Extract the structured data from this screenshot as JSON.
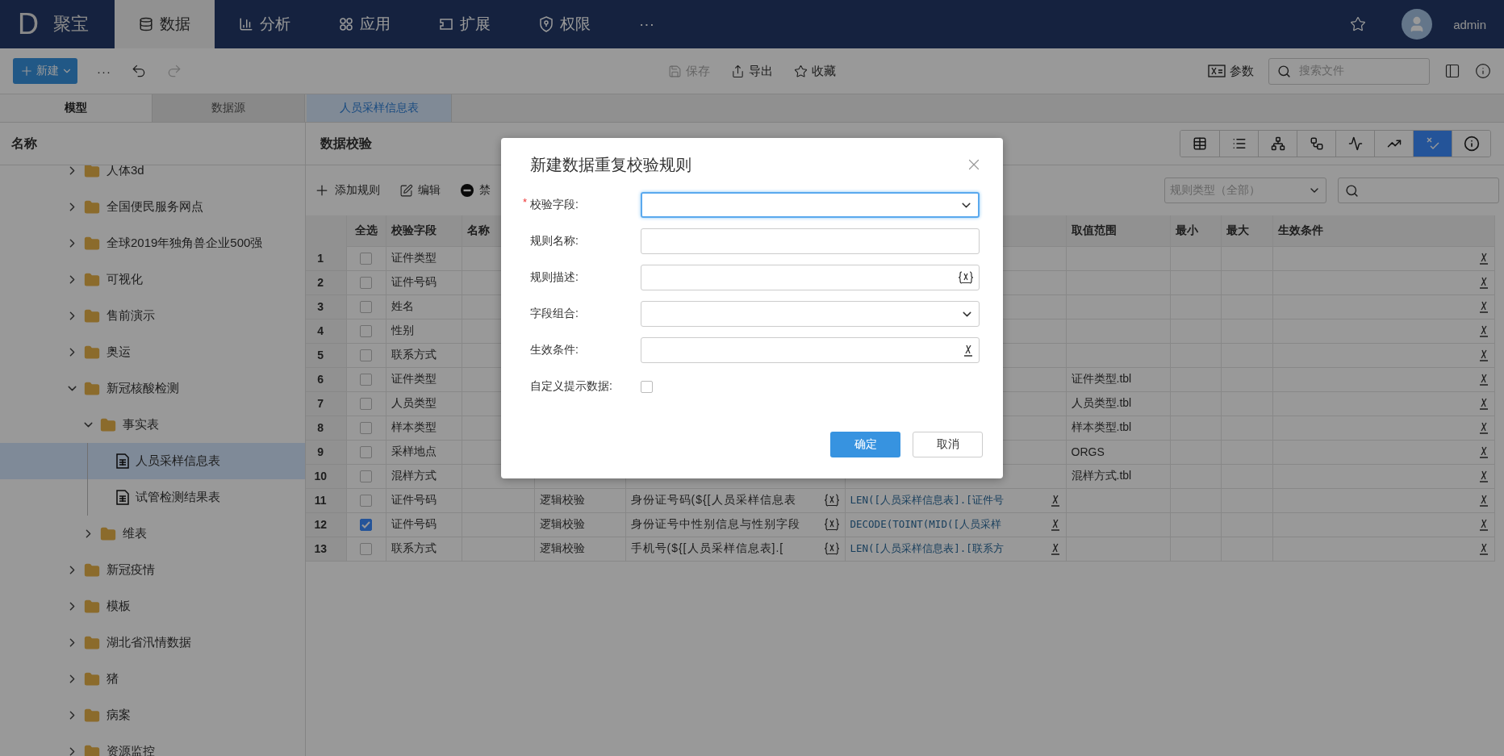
{
  "app": {
    "logo": "D",
    "name": "聚宝"
  },
  "nav": [
    {
      "label": "数据",
      "selected": true
    },
    {
      "label": "分析",
      "selected": false
    },
    {
      "label": "应用",
      "selected": false
    },
    {
      "label": "扩展",
      "selected": false
    },
    {
      "label": "权限",
      "selected": false
    },
    {
      "label": "···",
      "selected": false
    }
  ],
  "user": {
    "name": "admin"
  },
  "toolbar": {
    "new_label": "新建",
    "more": "···",
    "save": {
      "label": "保存",
      "disabled": true
    },
    "export": "导出",
    "favorite": "收藏",
    "params": "参数",
    "search_placeholder": "搜索文件"
  },
  "side_tabs": [
    {
      "label": "模型",
      "selected": true
    },
    {
      "label": "数据源",
      "selected": false
    }
  ],
  "doc_tabs": [
    {
      "label": "人员采样信息表",
      "selected": true
    }
  ],
  "tree": {
    "header": "名称",
    "items": [
      {
        "label": "人体3d",
        "kind": "folder",
        "expanded": false
      },
      {
        "label": "全国便民服务网点",
        "kind": "folder",
        "expanded": false
      },
      {
        "label": "全球2019年独角兽企业500强",
        "kind": "folder",
        "expanded": false
      },
      {
        "label": "可视化",
        "kind": "folder",
        "expanded": false
      },
      {
        "label": "售前演示",
        "kind": "folder",
        "expanded": false
      },
      {
        "label": "奥运",
        "kind": "folder",
        "expanded": false
      },
      {
        "label": "新冠核酸检测",
        "kind": "folder",
        "expanded": true,
        "children": [
          {
            "label": "事实表",
            "kind": "folder",
            "expanded": true,
            "children": [
              {
                "label": "人员采样信息表",
                "kind": "table",
                "selected": true
              },
              {
                "label": "试管检测结果表",
                "kind": "table",
                "selected": false
              }
            ]
          },
          {
            "label": "维表",
            "kind": "folder",
            "expanded": false
          }
        ]
      },
      {
        "label": "新冠疫情",
        "kind": "folder",
        "expanded": false
      },
      {
        "label": "模板",
        "kind": "folder",
        "expanded": false
      },
      {
        "label": "湖北省汛情数据",
        "kind": "folder",
        "expanded": false
      },
      {
        "label": "猪",
        "kind": "folder",
        "expanded": false
      },
      {
        "label": "病案",
        "kind": "folder",
        "expanded": false
      },
      {
        "label": "资源监控",
        "kind": "folder",
        "expanded": false
      }
    ]
  },
  "panel": {
    "title": "数据校验",
    "views": [
      {
        "selected": false
      },
      {
        "selected": false
      },
      {
        "selected": false
      },
      {
        "selected": false
      },
      {
        "selected": false
      },
      {
        "selected": false
      },
      {
        "selected": true
      },
      {
        "selected": false
      }
    ],
    "actions": [
      {
        "label": "添加规则"
      },
      {
        "label": "编辑"
      },
      {
        "label": "禁"
      }
    ],
    "rule_type_placeholder": "规则类型（全部）"
  },
  "table": {
    "headers": {
      "select_all": "全选",
      "field": "校验字段",
      "name": "名称",
      "range": "取值范围",
      "min": "最小",
      "max": "最大",
      "condition": "生效条件"
    },
    "rows": [
      {
        "num": "1",
        "checked": false,
        "field": "证件类型"
      },
      {
        "num": "2",
        "checked": false,
        "field": "证件号码"
      },
      {
        "num": "3",
        "checked": false,
        "field": "姓名"
      },
      {
        "num": "4",
        "checked": false,
        "field": "性别"
      },
      {
        "num": "5",
        "checked": false,
        "field": "联系方式"
      },
      {
        "num": "6",
        "checked": false,
        "field": "证件类型",
        "range": "证件类型.tbl"
      },
      {
        "num": "7",
        "checked": false,
        "field": "人员类型",
        "range": "人员类型.tbl"
      },
      {
        "num": "8",
        "checked": false,
        "field": "样本类型",
        "range": "样本类型.tbl"
      },
      {
        "num": "9",
        "checked": false,
        "field": "采样地点",
        "range": "ORGS"
      },
      {
        "num": "10",
        "checked": false,
        "field": "混样方式",
        "range": "混样方式.tbl"
      },
      {
        "num": "11",
        "checked": false,
        "field": "证件号码",
        "type": "逻辑校验",
        "description": "身份证号码(${[人员采样信息表",
        "expression": "LEN([人员采样信息表].[证件号"
      },
      {
        "num": "12",
        "checked": true,
        "field": "证件号码",
        "type": "逻辑校验",
        "description": "身份证号中性别信息与性别字段",
        "expression": "DECODE(TOINT(MID([人员采样"
      },
      {
        "num": "13",
        "checked": false,
        "field": "联系方式",
        "type": "逻辑校验",
        "description": "手机号(${[人员采样信息表].[",
        "expression": "LEN([人员采样信息表].[联系方"
      }
    ]
  },
  "dialog": {
    "title": "新建数据重复校验规则",
    "required_mark": "*",
    "fields": [
      {
        "label": "校验字段:",
        "kind": "select",
        "required": true,
        "focused": true
      },
      {
        "label": "规则名称:",
        "kind": "text",
        "required": false,
        "focused": false
      },
      {
        "label": "规则描述:",
        "kind": "formula",
        "required": false,
        "focused": false
      },
      {
        "label": "字段组合:",
        "kind": "select",
        "required": false,
        "focused": false
      },
      {
        "label": "生效条件:",
        "kind": "condition",
        "required": false,
        "focused": false
      },
      {
        "label": "自定义提示数据:",
        "kind": "checkbox",
        "checked": false,
        "required": false
      }
    ],
    "buttons": [
      {
        "label": "确定",
        "kind": "primary"
      },
      {
        "label": "取消",
        "kind": "default"
      }
    ]
  }
}
